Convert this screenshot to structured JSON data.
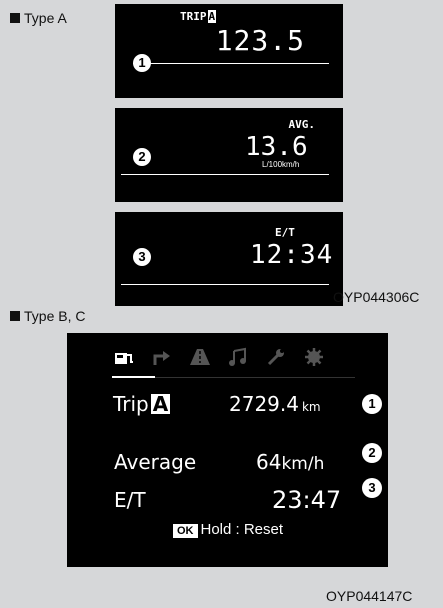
{
  "type_a": {
    "caption": "Type A",
    "panel1": {
      "label": "TRIP",
      "label_box": "A",
      "value": "123.5",
      "marker": "1"
    },
    "panel2": {
      "label": "AVG.",
      "value": "13.6",
      "unit": "L/100km/h",
      "marker": "2"
    },
    "panel3": {
      "label": "E/T",
      "value": "12:34",
      "marker": "3"
    },
    "code": "OYP044306C"
  },
  "type_bc": {
    "caption": "Type B, C",
    "icons": [
      "fuel-icon",
      "turn-arrow-icon",
      "road-icon",
      "music-note-icon",
      "wrench-icon",
      "gear-icon"
    ],
    "trip": {
      "label": "Trip",
      "label_box": "A",
      "value": "2729.4",
      "unit": "km",
      "marker": "1"
    },
    "average": {
      "label": "Average",
      "value": "64",
      "unit": "km/h",
      "marker": "2"
    },
    "elapsed": {
      "label": "E/T",
      "value": "23:47",
      "marker": "3"
    },
    "reset": {
      "ok": "OK",
      "text": "Hold : Reset"
    },
    "code": "OYP044147C"
  },
  "colors": {
    "background": "#d6d7d9",
    "display": "#000000",
    "text": "#ffffff"
  }
}
